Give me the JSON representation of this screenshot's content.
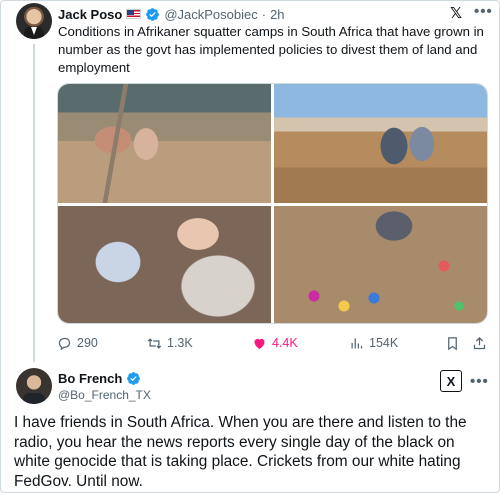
{
  "tweet1": {
    "author_name": "Jack Poso",
    "author_flag": "US flag",
    "handle": "@JackPosobiec",
    "separator": "·",
    "time": "2h",
    "text": "Conditions in Afrikaner squatter camps in South Africa that have grown in number as the govt has implemented policies to divest them of land and employment",
    "images": [
      {
        "description": "family-outside-shack"
      },
      {
        "description": "children-on-wooden-boards"
      },
      {
        "description": "woman-holding-baby"
      },
      {
        "description": "child-with-scattered-toys"
      }
    ],
    "stats": {
      "replies": "290",
      "reposts": "1.3K",
      "likes": "4.4K",
      "views": "154K"
    },
    "verified_color": "#1d9bf0",
    "like_color": "#f91880"
  },
  "tweet2": {
    "author_name": "Bo French",
    "handle": "@Bo_French_TX",
    "text": "I have friends in South Africa. When you are there and listen to the radio, you hear the news reports every single day of the black on white genocide that is taking place. Crickets from our white hating FedGov. Until now."
  },
  "icons": {
    "more": "•••",
    "x_logo": "X⃥"
  }
}
